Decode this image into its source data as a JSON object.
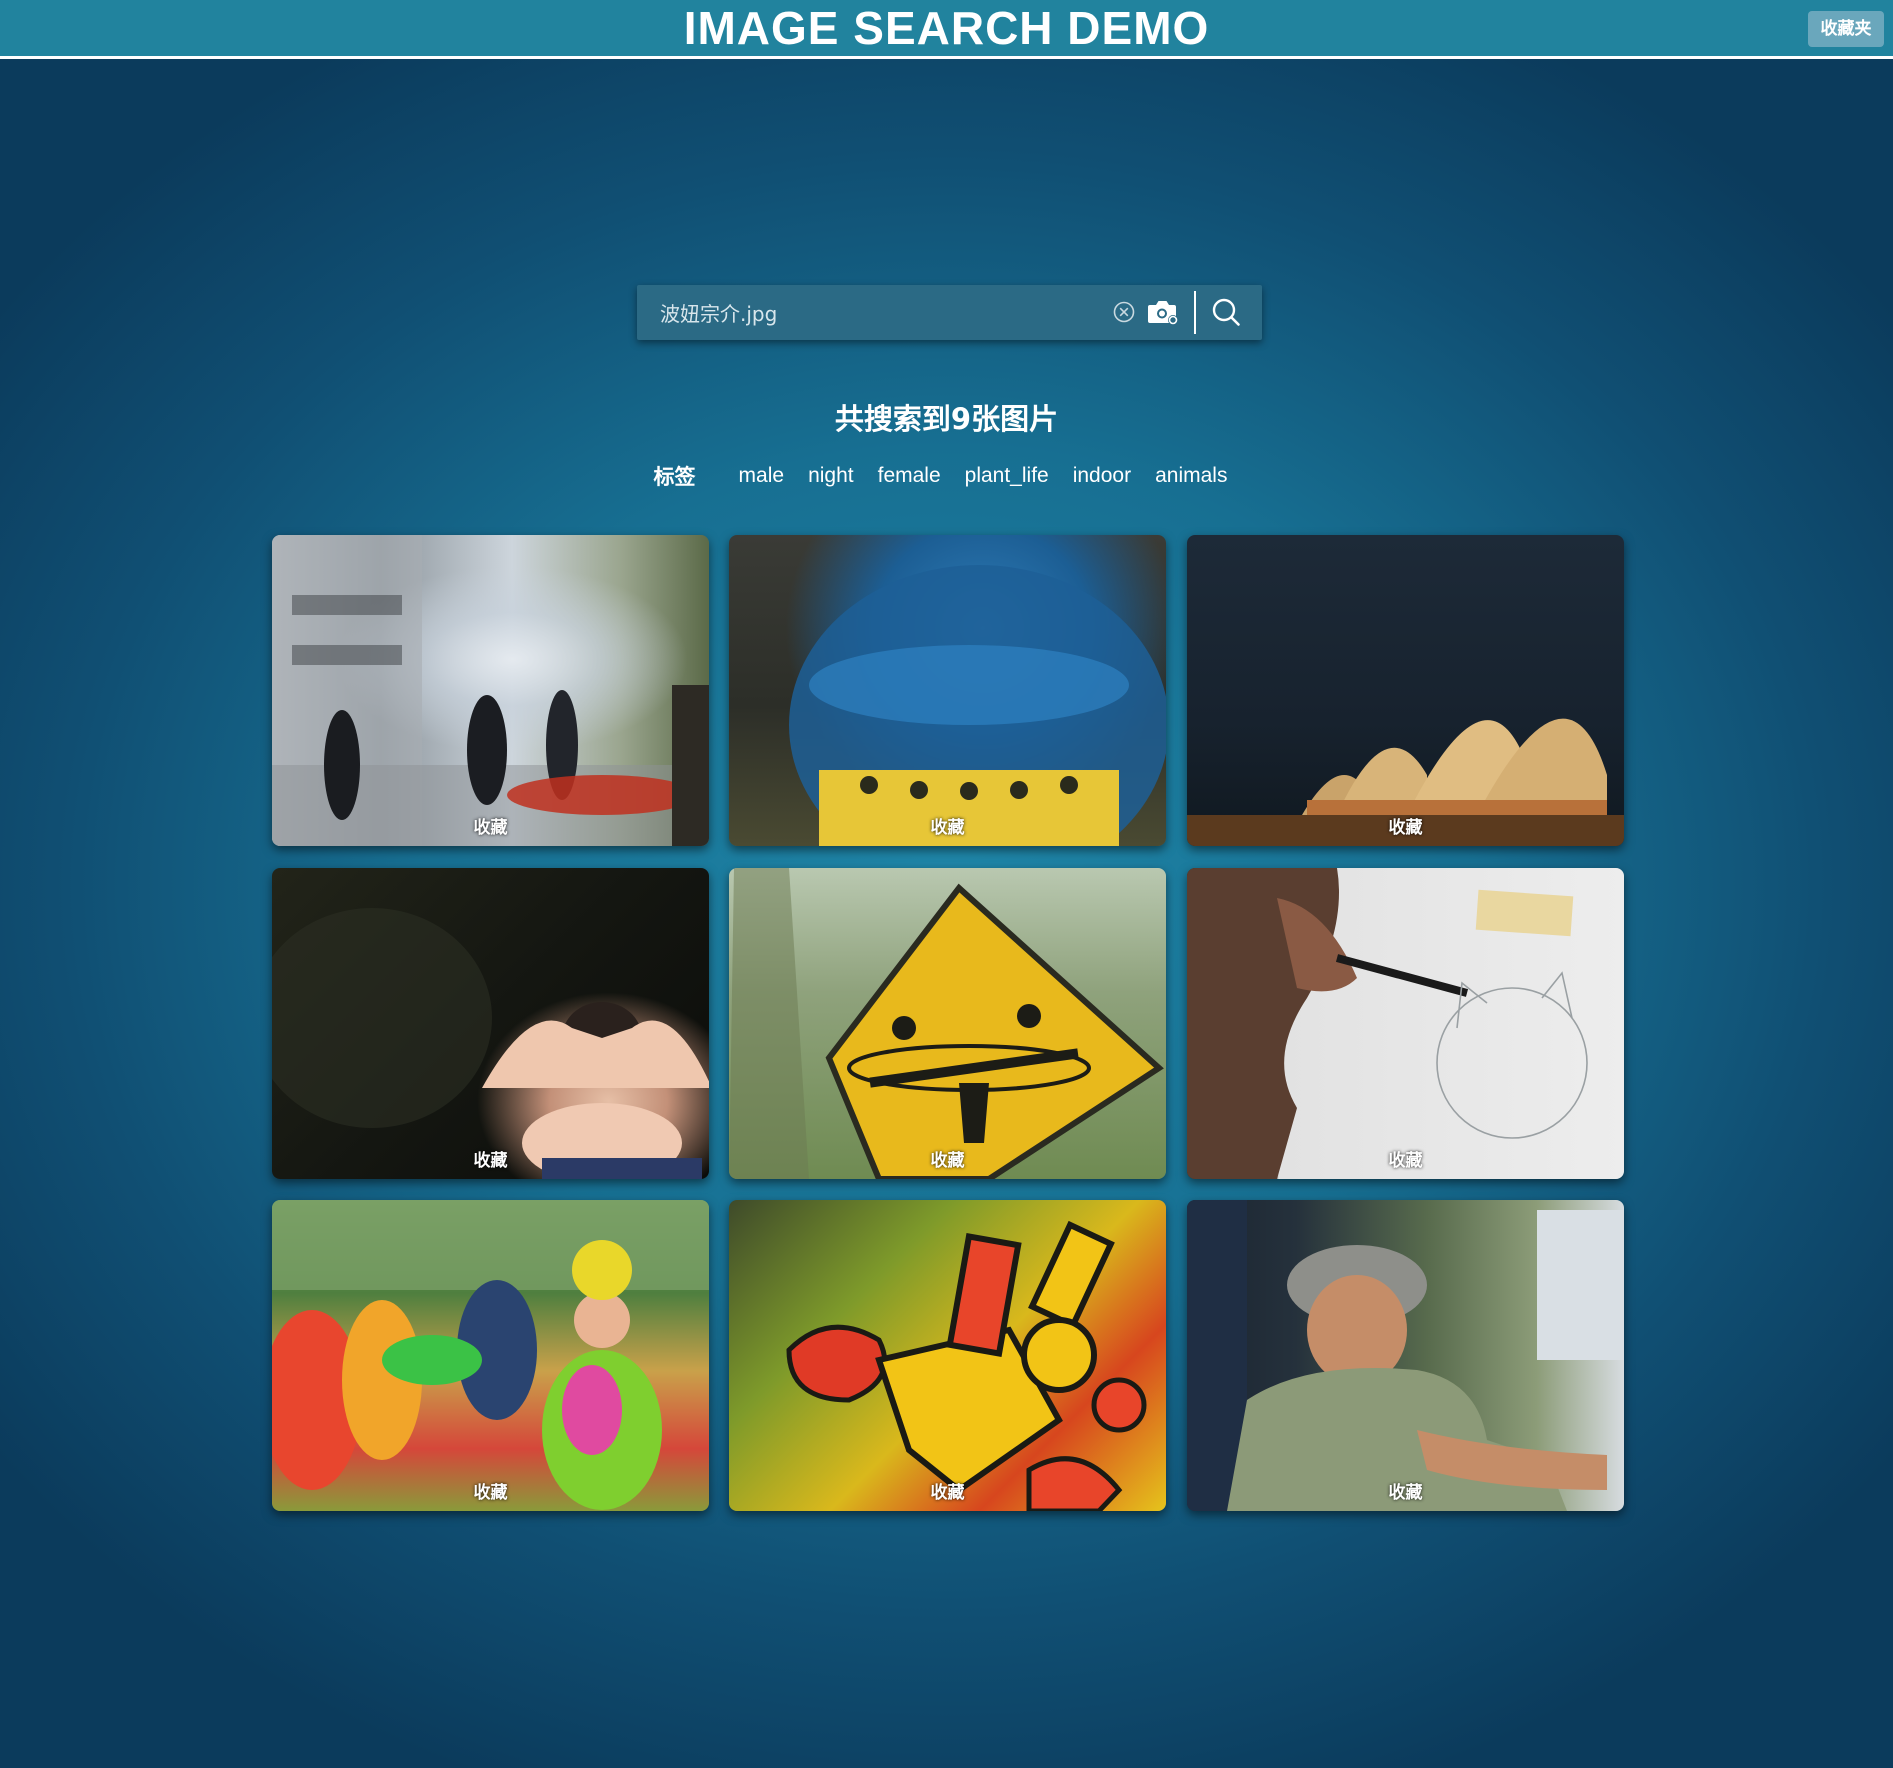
{
  "header": {
    "title": "IMAGE SEARCH DEMO",
    "favorites_button": "收藏夹"
  },
  "search": {
    "value": "波妞宗介.jpg",
    "placeholder": ""
  },
  "results": {
    "summary": "共搜索到9张图片"
  },
  "tags": {
    "heading": "标签",
    "items": [
      "male",
      "night",
      "female",
      "plant_life",
      "indoor",
      "animals"
    ]
  },
  "images": [
    {
      "subject": "street-protest-photo",
      "favorite_label": "收藏"
    },
    {
      "subject": "blue-cap-toy-photo",
      "favorite_label": "收藏"
    },
    {
      "subject": "opera-house-night-photo",
      "favorite_label": "收藏"
    },
    {
      "subject": "woman-covering-eyes-photo",
      "favorite_label": "收藏"
    },
    {
      "subject": "seesaw-road-sign-photo",
      "favorite_label": "收藏"
    },
    {
      "subject": "pencil-drawing-photo",
      "favorite_label": "收藏"
    },
    {
      "subject": "carnival-parade-photo",
      "favorite_label": "收藏"
    },
    {
      "subject": "graffiti-wall-photo",
      "favorite_label": "收藏"
    },
    {
      "subject": "young-man-cap-photo",
      "favorite_label": "收藏"
    }
  ],
  "colors": {
    "header_bg": "#21839e",
    "page_bg_center": "#1f86a8",
    "page_bg_edge": "#0b3b5c",
    "search_bg": "#2b6a85",
    "favorites_button_bg": "#6aa7bc"
  },
  "icons": {
    "clear": "clear-icon",
    "camera": "camera-icon",
    "search": "search-icon"
  }
}
